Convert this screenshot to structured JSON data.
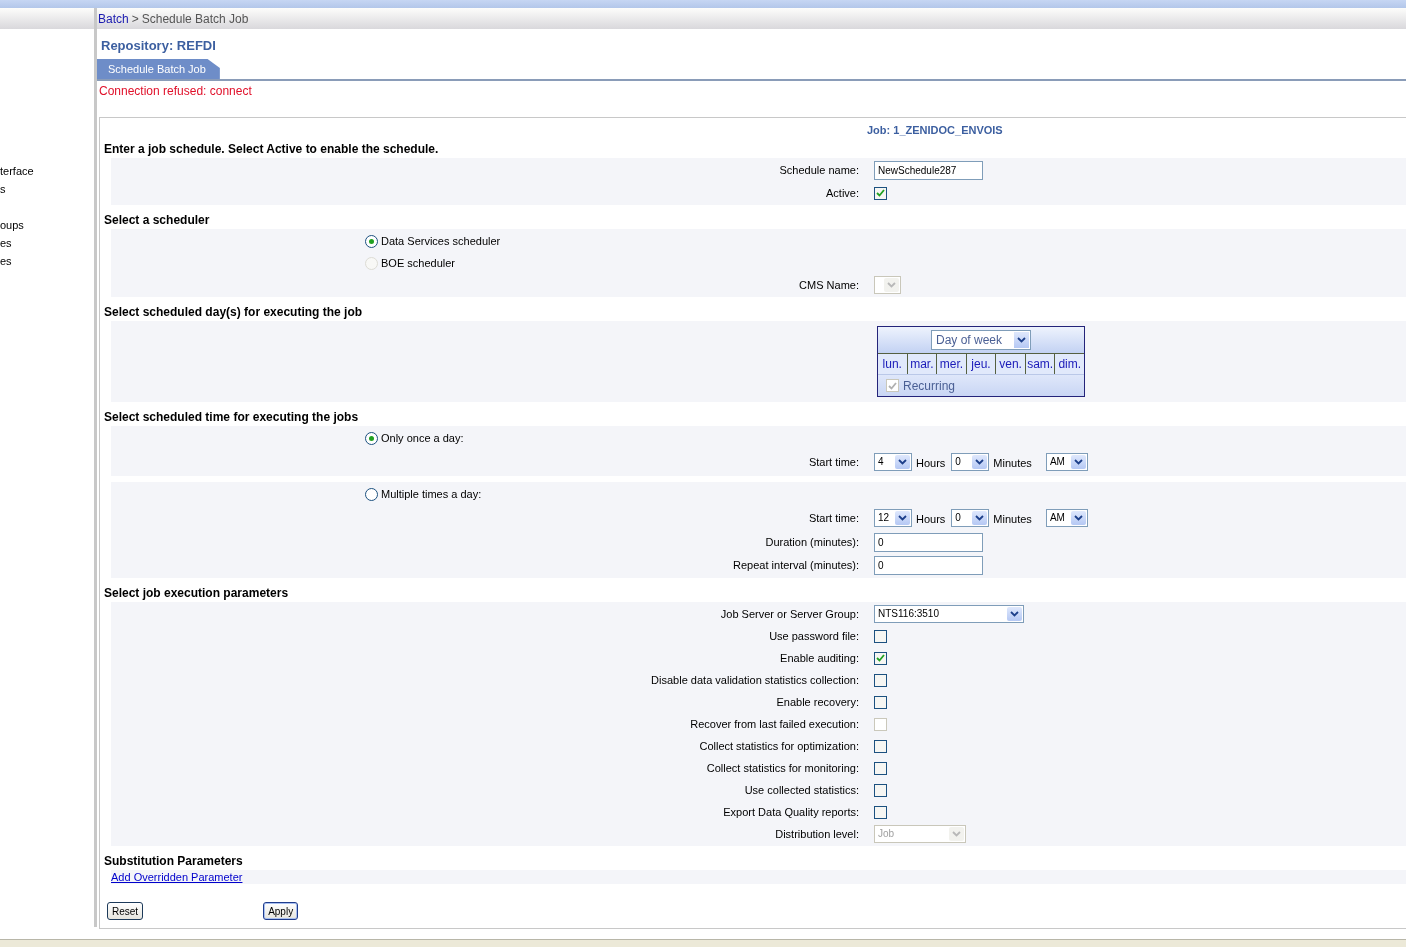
{
  "breadcrumb": {
    "link": "Batch",
    "separator": ">",
    "current": "Schedule Batch Job"
  },
  "sidebar": {
    "groups": [
      [
        "terface",
        "s"
      ],
      [
        "oups",
        "es",
        "es"
      ]
    ]
  },
  "repository_title": "Repository: REFDI",
  "tabs": [
    {
      "label": "Schedule Batch Job",
      "selected": true
    }
  ],
  "error": "Connection refused: connect",
  "job_title": "Job: 1_ZENIDOC_ENVOIS",
  "sections": [
    {
      "heading": "Enter a job schedule. Select Active to enable the schedule.",
      "bands": [
        [
          {
            "kind": "text",
            "label": "Schedule name:",
            "value": "NewSchedule287"
          },
          {
            "kind": "checkbox",
            "label": "Active:",
            "checked": true,
            "disabled": false
          }
        ]
      ]
    },
    {
      "heading": "Select a scheduler",
      "bands": [
        [
          {
            "kind": "radio",
            "label": "Data Services scheduler",
            "selected": true,
            "disabled": false
          },
          {
            "kind": "radio",
            "label": "BOE scheduler",
            "selected": false,
            "disabled": true
          },
          {
            "kind": "select",
            "label": "CMS Name:",
            "disabled": true
          }
        ]
      ]
    },
    {
      "heading": "Select scheduled day(s) for executing the job",
      "bands": [
        [
          {
            "kind": "calendar",
            "mode": "Day of week",
            "days": [
              "lun.",
              "mar.",
              "mer.",
              "jeu.",
              "ven.",
              "sam.",
              "dim."
            ],
            "recurring": {
              "label": "Recurring",
              "checked": true,
              "disabled": true
            }
          }
        ]
      ]
    },
    {
      "heading": "Select scheduled time for executing the jobs",
      "bands": [
        [
          {
            "kind": "radio",
            "label": "Only once a day:",
            "selected": true,
            "disabled": false
          },
          {
            "kind": "time",
            "label": "Start time:",
            "hour": "4",
            "hours_label": "Hours",
            "minute": "0",
            "minutes_label": "Minutes",
            "period": "AM"
          }
        ],
        [
          {
            "kind": "radio",
            "label": "Multiple times a day:",
            "selected": false,
            "disabled": false
          },
          {
            "kind": "time",
            "label": "Start time:",
            "hour": "12",
            "hours_label": "Hours",
            "minute": "0",
            "minutes_label": "Minutes",
            "period": "AM"
          },
          {
            "kind": "text",
            "label": "Duration (minutes):",
            "value": "0"
          },
          {
            "kind": "text",
            "label": "Repeat interval (minutes):",
            "value": "0"
          }
        ]
      ]
    },
    {
      "heading": "Select job execution parameters",
      "bands": [
        [
          {
            "kind": "select",
            "label": "Job Server or Server Group:",
            "value": "NTS116:3510",
            "disabled": false
          },
          {
            "kind": "checkbox",
            "label": "Use password file:",
            "checked": false,
            "disabled": false
          },
          {
            "kind": "checkbox",
            "label": "Enable auditing:",
            "checked": true,
            "disabled": false
          },
          {
            "kind": "checkbox",
            "label": "Disable data validation statistics collection:",
            "checked": false,
            "disabled": false
          },
          {
            "kind": "checkbox",
            "label": "Enable recovery:",
            "checked": false,
            "disabled": false
          },
          {
            "kind": "checkbox",
            "label": "Recover from last failed execution:",
            "checked": false,
            "disabled": true
          },
          {
            "kind": "checkbox",
            "label": "Collect statistics for optimization:",
            "checked": false,
            "disabled": false
          },
          {
            "kind": "checkbox",
            "label": "Collect statistics for monitoring:",
            "checked": false,
            "disabled": false
          },
          {
            "kind": "checkbox",
            "label": "Use collected statistics:",
            "checked": false,
            "disabled": false
          },
          {
            "kind": "checkbox",
            "label": "Export Data Quality reports:",
            "checked": false,
            "disabled": false
          },
          {
            "kind": "select",
            "label": "Distribution level:",
            "value": "Job",
            "disabled": true
          }
        ]
      ]
    },
    {
      "heading": "Substitution Parameters",
      "bands": [
        [
          {
            "kind": "link",
            "label": "Add Overridden Parameter"
          }
        ]
      ]
    }
  ],
  "buttons": [
    {
      "label": "Reset",
      "default": false
    },
    {
      "label": "Apply",
      "default": true
    }
  ]
}
